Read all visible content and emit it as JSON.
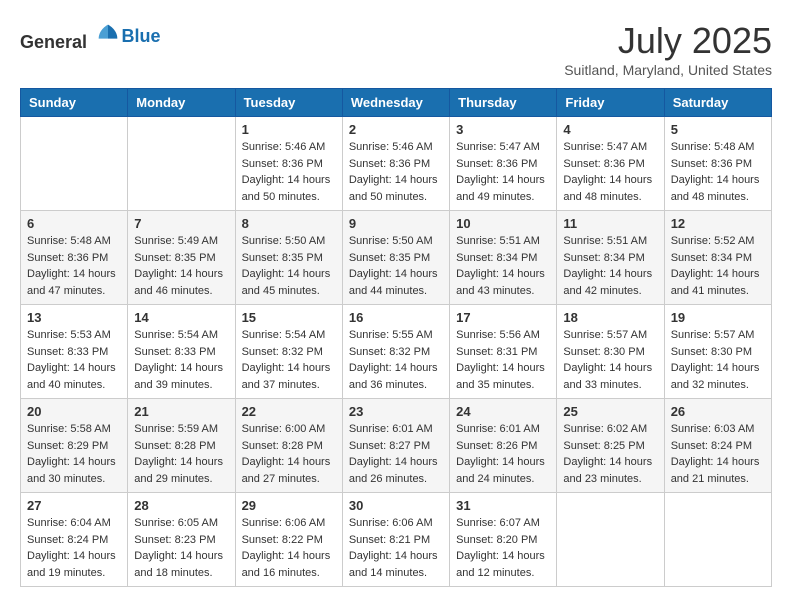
{
  "header": {
    "logo_general": "General",
    "logo_blue": "Blue",
    "month_title": "July 2025",
    "location": "Suitland, Maryland, United States"
  },
  "days_of_week": [
    "Sunday",
    "Monday",
    "Tuesday",
    "Wednesday",
    "Thursday",
    "Friday",
    "Saturday"
  ],
  "weeks": [
    [
      {
        "day": "",
        "content": ""
      },
      {
        "day": "",
        "content": ""
      },
      {
        "day": "1",
        "content": "Sunrise: 5:46 AM\nSunset: 8:36 PM\nDaylight: 14 hours\nand 50 minutes."
      },
      {
        "day": "2",
        "content": "Sunrise: 5:46 AM\nSunset: 8:36 PM\nDaylight: 14 hours\nand 50 minutes."
      },
      {
        "day": "3",
        "content": "Sunrise: 5:47 AM\nSunset: 8:36 PM\nDaylight: 14 hours\nand 49 minutes."
      },
      {
        "day": "4",
        "content": "Sunrise: 5:47 AM\nSunset: 8:36 PM\nDaylight: 14 hours\nand 48 minutes."
      },
      {
        "day": "5",
        "content": "Sunrise: 5:48 AM\nSunset: 8:36 PM\nDaylight: 14 hours\nand 48 minutes."
      }
    ],
    [
      {
        "day": "6",
        "content": "Sunrise: 5:48 AM\nSunset: 8:36 PM\nDaylight: 14 hours\nand 47 minutes."
      },
      {
        "day": "7",
        "content": "Sunrise: 5:49 AM\nSunset: 8:35 PM\nDaylight: 14 hours\nand 46 minutes."
      },
      {
        "day": "8",
        "content": "Sunrise: 5:50 AM\nSunset: 8:35 PM\nDaylight: 14 hours\nand 45 minutes."
      },
      {
        "day": "9",
        "content": "Sunrise: 5:50 AM\nSunset: 8:35 PM\nDaylight: 14 hours\nand 44 minutes."
      },
      {
        "day": "10",
        "content": "Sunrise: 5:51 AM\nSunset: 8:34 PM\nDaylight: 14 hours\nand 43 minutes."
      },
      {
        "day": "11",
        "content": "Sunrise: 5:51 AM\nSunset: 8:34 PM\nDaylight: 14 hours\nand 42 minutes."
      },
      {
        "day": "12",
        "content": "Sunrise: 5:52 AM\nSunset: 8:34 PM\nDaylight: 14 hours\nand 41 minutes."
      }
    ],
    [
      {
        "day": "13",
        "content": "Sunrise: 5:53 AM\nSunset: 8:33 PM\nDaylight: 14 hours\nand 40 minutes."
      },
      {
        "day": "14",
        "content": "Sunrise: 5:54 AM\nSunset: 8:33 PM\nDaylight: 14 hours\nand 39 minutes."
      },
      {
        "day": "15",
        "content": "Sunrise: 5:54 AM\nSunset: 8:32 PM\nDaylight: 14 hours\nand 37 minutes."
      },
      {
        "day": "16",
        "content": "Sunrise: 5:55 AM\nSunset: 8:32 PM\nDaylight: 14 hours\nand 36 minutes."
      },
      {
        "day": "17",
        "content": "Sunrise: 5:56 AM\nSunset: 8:31 PM\nDaylight: 14 hours\nand 35 minutes."
      },
      {
        "day": "18",
        "content": "Sunrise: 5:57 AM\nSunset: 8:30 PM\nDaylight: 14 hours\nand 33 minutes."
      },
      {
        "day": "19",
        "content": "Sunrise: 5:57 AM\nSunset: 8:30 PM\nDaylight: 14 hours\nand 32 minutes."
      }
    ],
    [
      {
        "day": "20",
        "content": "Sunrise: 5:58 AM\nSunset: 8:29 PM\nDaylight: 14 hours\nand 30 minutes."
      },
      {
        "day": "21",
        "content": "Sunrise: 5:59 AM\nSunset: 8:28 PM\nDaylight: 14 hours\nand 29 minutes."
      },
      {
        "day": "22",
        "content": "Sunrise: 6:00 AM\nSunset: 8:28 PM\nDaylight: 14 hours\nand 27 minutes."
      },
      {
        "day": "23",
        "content": "Sunrise: 6:01 AM\nSunset: 8:27 PM\nDaylight: 14 hours\nand 26 minutes."
      },
      {
        "day": "24",
        "content": "Sunrise: 6:01 AM\nSunset: 8:26 PM\nDaylight: 14 hours\nand 24 minutes."
      },
      {
        "day": "25",
        "content": "Sunrise: 6:02 AM\nSunset: 8:25 PM\nDaylight: 14 hours\nand 23 minutes."
      },
      {
        "day": "26",
        "content": "Sunrise: 6:03 AM\nSunset: 8:24 PM\nDaylight: 14 hours\nand 21 minutes."
      }
    ],
    [
      {
        "day": "27",
        "content": "Sunrise: 6:04 AM\nSunset: 8:24 PM\nDaylight: 14 hours\nand 19 minutes."
      },
      {
        "day": "28",
        "content": "Sunrise: 6:05 AM\nSunset: 8:23 PM\nDaylight: 14 hours\nand 18 minutes."
      },
      {
        "day": "29",
        "content": "Sunrise: 6:06 AM\nSunset: 8:22 PM\nDaylight: 14 hours\nand 16 minutes."
      },
      {
        "day": "30",
        "content": "Sunrise: 6:06 AM\nSunset: 8:21 PM\nDaylight: 14 hours\nand 14 minutes."
      },
      {
        "day": "31",
        "content": "Sunrise: 6:07 AM\nSunset: 8:20 PM\nDaylight: 14 hours\nand 12 minutes."
      },
      {
        "day": "",
        "content": ""
      },
      {
        "day": "",
        "content": ""
      }
    ]
  ]
}
